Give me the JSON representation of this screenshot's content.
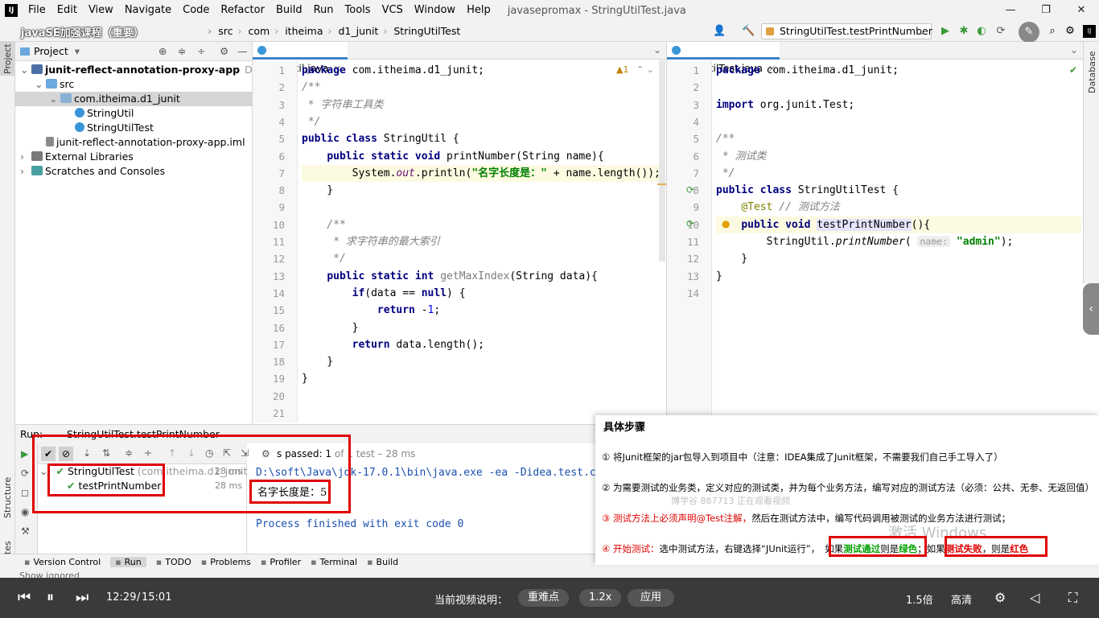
{
  "menu": {
    "items": [
      "File",
      "Edit",
      "View",
      "Navigate",
      "Code",
      "Refactor",
      "Build",
      "Run",
      "Tools",
      "VCS",
      "Window",
      "Help"
    ],
    "window_title": "javasepromax - StringUtilTest.java"
  },
  "nav": {
    "overlay_title": "javaSE加强课程（重要）",
    "crumbs": [
      "junit-reflect-annotation-proxy-app",
      "src",
      "com",
      "itheima",
      "d1_junit",
      "StringUtilTest"
    ],
    "run_config": "StringUtilTest.testPrintNumber"
  },
  "project": {
    "header": "Project",
    "tree": [
      {
        "label": "junit-reflect-annotation-proxy-app",
        "extra": "D:\\code\\j",
        "indent": 0,
        "icon": "mod",
        "arrow": "⌄",
        "bold": true
      },
      {
        "label": "src",
        "extra": "",
        "indent": 1,
        "icon": "folder",
        "arrow": "⌄",
        "bold": false
      },
      {
        "label": "com.itheima.d1_junit",
        "extra": "",
        "indent": 2,
        "icon": "pkg",
        "arrow": "⌄",
        "bold": false,
        "selected": true
      },
      {
        "label": "StringUtil",
        "extra": "",
        "indent": 3,
        "icon": "cls",
        "arrow": "",
        "bold": false
      },
      {
        "label": "StringUtilTest",
        "extra": "",
        "indent": 3,
        "icon": "cls",
        "arrow": "",
        "bold": false
      },
      {
        "label": "junit-reflect-annotation-proxy-app.iml",
        "extra": "",
        "indent": 1,
        "icon": "iml",
        "arrow": "",
        "bold": false
      },
      {
        "label": "External Libraries",
        "extra": "",
        "indent": 0,
        "icon": "lib",
        "arrow": "›",
        "bold": false
      },
      {
        "label": "Scratches and Consoles",
        "extra": "",
        "indent": 0,
        "icon": "scr",
        "arrow": "›",
        "bold": false
      }
    ]
  },
  "left_strip": {
    "project": "Project",
    "structure": "Structure",
    "favorites": "Favorites"
  },
  "editor_left": {
    "tab": "StringUtil.java",
    "warning": "▲1",
    "line_numbers": [
      "1",
      "2",
      "3",
      "4",
      "5",
      "6",
      "7",
      "8",
      "9",
      "10",
      "11",
      "12",
      "13",
      "14",
      "15",
      "16",
      "17",
      "18",
      "19",
      "20",
      "21"
    ],
    "lines": [
      "package com.itheima.d1_junit;",
      "/**",
      " * 字符串工具类",
      " */",
      "public class StringUtil {",
      "    public static void printNumber(String name){",
      "        System.out.println(\"名字长度是：\" + name.length());",
      "    }",
      "",
      "    /**",
      "     * 求字符串的最大索引",
      "     */",
      "    public static int getMaxIndex(String data){",
      "        if(data == null) {",
      "            return -1;",
      "        }",
      "        return data.length();",
      "    }",
      "}",
      "",
      ""
    ]
  },
  "editor_right": {
    "tab": "StringUtilTest.java",
    "line_numbers": [
      "1",
      "2",
      "3",
      "4",
      "5",
      "6",
      "7",
      "8",
      "9",
      "10",
      "11",
      "12",
      "13",
      "14"
    ],
    "lines": [
      "package com.itheima.d1_junit;",
      "",
      "import org.junit.Test;",
      "",
      "/**",
      " * 测试类",
      " */",
      "public class StringUtilTest {",
      "    @Test // 测试方法",
      "    public void testPrintNumber(){",
      "        StringUtil.printNumber( name: \"admin\");",
      "    }",
      "}",
      ""
    ],
    "param_hint": "name:"
  },
  "run": {
    "label": "Run:",
    "tab": "StringUtilTest.testPrintNumber",
    "status_prefix": "s passed:",
    "status_count": "1",
    "status_of": "of 1 test – 28 ms",
    "tests": [
      {
        "name": "StringUtilTest",
        "extra": "(com.itheima.d1_junit",
        "time": "28 ms"
      },
      {
        "name": "testPrintNumber",
        "extra": "",
        "time": "28 ms"
      }
    ],
    "console_cmd": "D:\\soft\\Java\\jdk-17.0.1\\bin\\java.exe -ea -Didea.test.c",
    "console_output": "名字长度是：5",
    "console_finish": "Process finished with exit code 0"
  },
  "bottom_tabs": [
    "Version Control",
    "Run",
    "TODO",
    "Problems",
    "Profiler",
    "Terminal",
    "Build"
  ],
  "status_text": "Show ignored",
  "steps_panel": {
    "title": "具体步骤",
    "step1": "①   将Junit框架的jar包导入到项目中（注意：IDEA集成了Junit框架，不需要我们自己手工导入了）",
    "step2": "②   为需要测试的业务类，定义对应的测试类，并为每个业务方法，编写对应的测试方法（必须：公共、无参、无返回值）",
    "step3a": "③   测试方法上必须声明@Test注解，",
    "step3b": "然后在测试方法中，编写代码调用被测试的业务方法进行测试；",
    "step4a": "④   开始测试：",
    "step4b": "选中测试方法，右键选择“JUnit运行”，",
    "step4c": "如果",
    "step4d": "测试通过",
    "step4e": "则是",
    "step4f": "绿色",
    "step4g": "；如果",
    "step4h": "测试失败",
    "step4i": "，则是",
    "step4j": "红色",
    "watermark1": "激活 Windows",
    "watermark2": "博学谷 887713 正在观看视频"
  },
  "player": {
    "time_current": "12:29",
    "time_sep": "/",
    "time_total": "15:01",
    "desc_label": "当前视频说明：",
    "pill_key": "重难点",
    "pill_speed": "1.2x",
    "pill_apply": "应用",
    "speed": "1.5倍",
    "quality": "高清"
  },
  "colors": {
    "accent": "#4083c9",
    "red_box": "#e00000",
    "pass_green": "#00a000"
  }
}
